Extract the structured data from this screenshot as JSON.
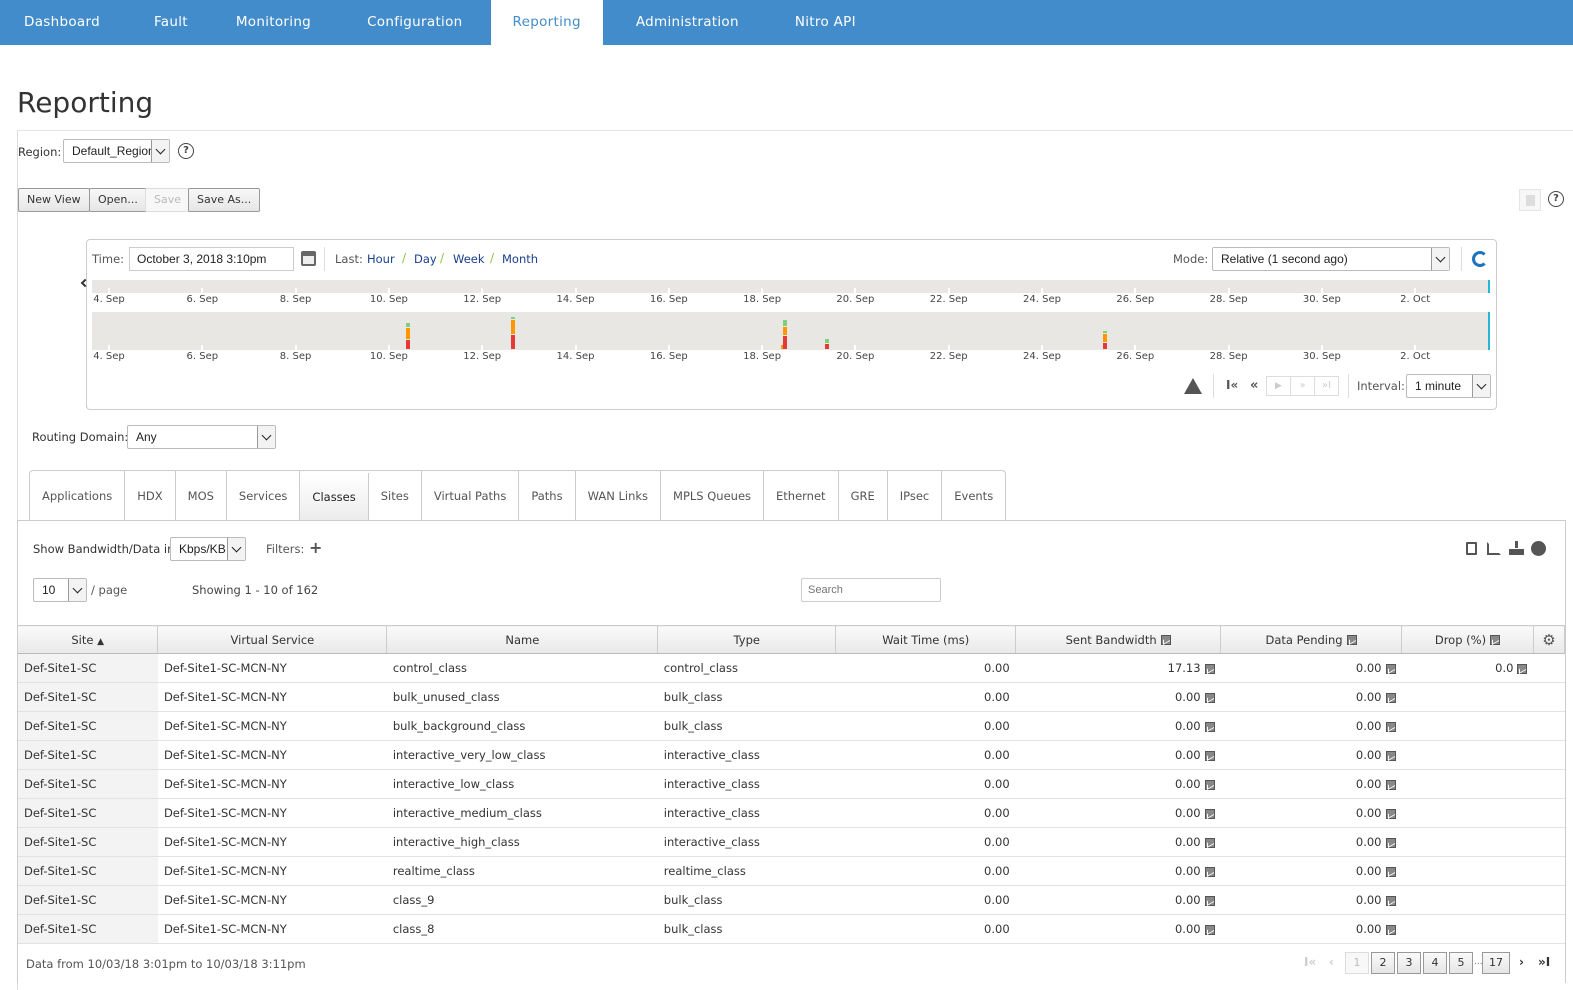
{
  "nav": {
    "items": [
      {
        "label": "Dashboard",
        "active": false
      },
      {
        "label": "Fault",
        "active": false
      },
      {
        "label": "Monitoring",
        "active": false
      },
      {
        "label": "Configuration",
        "active": false
      },
      {
        "label": "Reporting",
        "active": true
      },
      {
        "label": "Administration",
        "active": false
      },
      {
        "label": "Nitro API",
        "active": false
      }
    ]
  },
  "page": {
    "title": "Reporting"
  },
  "region": {
    "label": "Region:",
    "value": "Default_Region"
  },
  "view_buttons": {
    "new_view": "New View",
    "open": "Open...",
    "save": "Save",
    "save_as": "Save As..."
  },
  "time": {
    "label": "Time:",
    "value": "October 3, 2018 3:10pm",
    "last_label": "Last:",
    "last_links": [
      "Hour",
      "Day",
      "Week",
      "Month"
    ],
    "mode_label": "Mode:",
    "mode_value": "Relative (1 second ago)",
    "interval_label": "Interval:",
    "interval_value": "1 minute"
  },
  "timeline": {
    "tick_labels": [
      "4. Sep",
      "6. Sep",
      "8. Sep",
      "10. Sep",
      "12. Sep",
      "14. Sep",
      "16. Sep",
      "18. Sep",
      "20. Sep",
      "22. Sep",
      "24. Sep",
      "26. Sep",
      "28. Sep",
      "30. Sep",
      "2. Oct"
    ],
    "colors": {
      "red": "#e53935",
      "orange": "#ff9800",
      "green": "#7ed07e",
      "marker": "#29b6d6"
    },
    "events": [
      {
        "day": 10.4,
        "red": 0.3,
        "orange": 0.35,
        "green": 0.15
      },
      {
        "day": 12.65,
        "red": 0.45,
        "orange": 0.45,
        "green": 0.1
      },
      {
        "day": 18.45,
        "red": 0.0,
        "orange": 0.15,
        "green": 0.0
      },
      {
        "day": 18.5,
        "red": 0.42,
        "orange": 0.28,
        "green": 0.2
      },
      {
        "day": 19.4,
        "red": 0.18,
        "orange": 0.0,
        "green": 0.15
      },
      {
        "day": 25.35,
        "red": 0.2,
        "orange": 0.28,
        "green": 0.1
      }
    ]
  },
  "routing_domain": {
    "label": "Routing Domain:",
    "value": "Any"
  },
  "tabs": [
    {
      "label": "Applications",
      "active": false
    },
    {
      "label": "HDX",
      "active": false
    },
    {
      "label": "MOS",
      "active": false
    },
    {
      "label": "Services",
      "active": false
    },
    {
      "label": "Classes",
      "active": true
    },
    {
      "label": "Sites",
      "active": false
    },
    {
      "label": "Virtual Paths",
      "active": false
    },
    {
      "label": "Paths",
      "active": false
    },
    {
      "label": "WAN Links",
      "active": false
    },
    {
      "label": "MPLS Queues",
      "active": false
    },
    {
      "label": "Ethernet",
      "active": false
    },
    {
      "label": "GRE",
      "active": false
    },
    {
      "label": "IPsec",
      "active": false
    },
    {
      "label": "Events",
      "active": false
    }
  ],
  "table_controls": {
    "bandwidth_label": "Show Bandwidth/Data in",
    "bandwidth_value": "Kbps/KB",
    "filters_label": "Filters:",
    "per_page_value": "10",
    "per_page_label": "/ page",
    "showing": "Showing 1 - 10 of 162",
    "search_placeholder": "Search"
  },
  "table": {
    "columns": [
      "Site",
      "Virtual Service",
      "Name",
      "Type",
      "Wait Time (ms)",
      "Sent Bandwidth",
      "Data Pending",
      "Drop (%)"
    ],
    "rows": [
      {
        "site": "Def-Site1-SC",
        "vs": "Def-Site1-SC-MCN-NY",
        "name": "control_class",
        "type": "control_class",
        "wait": "0.00",
        "sent": "17.13",
        "pending": "0.00",
        "drop": "0.0"
      },
      {
        "site": "Def-Site1-SC",
        "vs": "Def-Site1-SC-MCN-NY",
        "name": "bulk_unused_class",
        "type": "bulk_class",
        "wait": "0.00",
        "sent": "0.00",
        "pending": "0.00",
        "drop": ""
      },
      {
        "site": "Def-Site1-SC",
        "vs": "Def-Site1-SC-MCN-NY",
        "name": "bulk_background_class",
        "type": "bulk_class",
        "wait": "0.00",
        "sent": "0.00",
        "pending": "0.00",
        "drop": ""
      },
      {
        "site": "Def-Site1-SC",
        "vs": "Def-Site1-SC-MCN-NY",
        "name": "interactive_very_low_class",
        "type": "interactive_class",
        "wait": "0.00",
        "sent": "0.00",
        "pending": "0.00",
        "drop": ""
      },
      {
        "site": "Def-Site1-SC",
        "vs": "Def-Site1-SC-MCN-NY",
        "name": "interactive_low_class",
        "type": "interactive_class",
        "wait": "0.00",
        "sent": "0.00",
        "pending": "0.00",
        "drop": ""
      },
      {
        "site": "Def-Site1-SC",
        "vs": "Def-Site1-SC-MCN-NY",
        "name": "interactive_medium_class",
        "type": "interactive_class",
        "wait": "0.00",
        "sent": "0.00",
        "pending": "0.00",
        "drop": ""
      },
      {
        "site": "Def-Site1-SC",
        "vs": "Def-Site1-SC-MCN-NY",
        "name": "interactive_high_class",
        "type": "interactive_class",
        "wait": "0.00",
        "sent": "0.00",
        "pending": "0.00",
        "drop": ""
      },
      {
        "site": "Def-Site1-SC",
        "vs": "Def-Site1-SC-MCN-NY",
        "name": "realtime_class",
        "type": "realtime_class",
        "wait": "0.00",
        "sent": "0.00",
        "pending": "0.00",
        "drop": ""
      },
      {
        "site": "Def-Site1-SC",
        "vs": "Def-Site1-SC-MCN-NY",
        "name": "class_9",
        "type": "bulk_class",
        "wait": "0.00",
        "sent": "0.00",
        "pending": "0.00",
        "drop": ""
      },
      {
        "site": "Def-Site1-SC",
        "vs": "Def-Site1-SC-MCN-NY",
        "name": "class_8",
        "type": "bulk_class",
        "wait": "0.00",
        "sent": "0.00",
        "pending": "0.00",
        "drop": ""
      }
    ]
  },
  "footer": {
    "data_range": "Data from 10/03/18 3:01pm to 10/03/18 3:11pm",
    "pages": [
      "1",
      "2",
      "3",
      "4",
      "5",
      "17"
    ],
    "current_page": "1",
    "ellipsis": "..."
  }
}
